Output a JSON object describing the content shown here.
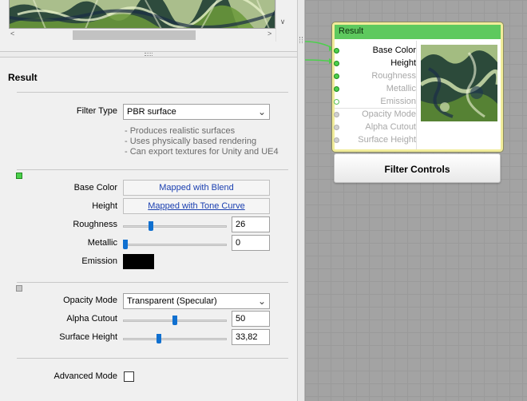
{
  "section_title": "Result",
  "filter_type": {
    "label": "Filter Type",
    "value": "PBR surface",
    "description": [
      "- Produces realistic surfaces",
      "- Uses physically based rendering",
      "- Can export textures for Unity and UE4"
    ]
  },
  "surface": {
    "base_color": {
      "label": "Base Color",
      "value": "Mapped with Blend"
    },
    "height": {
      "label": "Height",
      "value": "Mapped with Tone Curve"
    },
    "roughness": {
      "label": "Roughness",
      "value": "26",
      "slider_fraction": 0.26
    },
    "metallic": {
      "label": "Metallic",
      "value": "0",
      "slider_fraction": 0.0
    },
    "emission": {
      "label": "Emission",
      "color": "#000000"
    }
  },
  "opacity": {
    "mode": {
      "label": "Opacity Mode",
      "value": "Transparent (Specular)"
    },
    "alpha_cutout": {
      "label": "Alpha Cutout",
      "value": "50",
      "slider_fraction": 0.5
    },
    "surface_height": {
      "label": "Surface Height",
      "value": "33,82",
      "slider_fraction": 0.34
    }
  },
  "advanced_mode": {
    "label": "Advanced Mode",
    "checked": false
  },
  "node": {
    "title": "Result",
    "ports": [
      {
        "label": "Base Color",
        "state": "connected"
      },
      {
        "label": "Height",
        "state": "connected"
      },
      {
        "label": "Roughness",
        "state": "inactive"
      },
      {
        "label": "Metallic",
        "state": "inactive"
      },
      {
        "label": "Emission",
        "state": "open"
      },
      {
        "label": "Opacity Mode",
        "state": "disabled"
      },
      {
        "label": "Alpha Cutout",
        "state": "disabled"
      },
      {
        "label": "Surface Height",
        "state": "disabled"
      }
    ]
  },
  "filter_controls_node": {
    "label": "Filter Controls"
  },
  "colors": {
    "accent": "#1070d0",
    "node_header": "#5ec95e",
    "node_border": "#f1ec9a",
    "port_connected": "#4cd04c",
    "link_text": "#1a3fb0"
  }
}
